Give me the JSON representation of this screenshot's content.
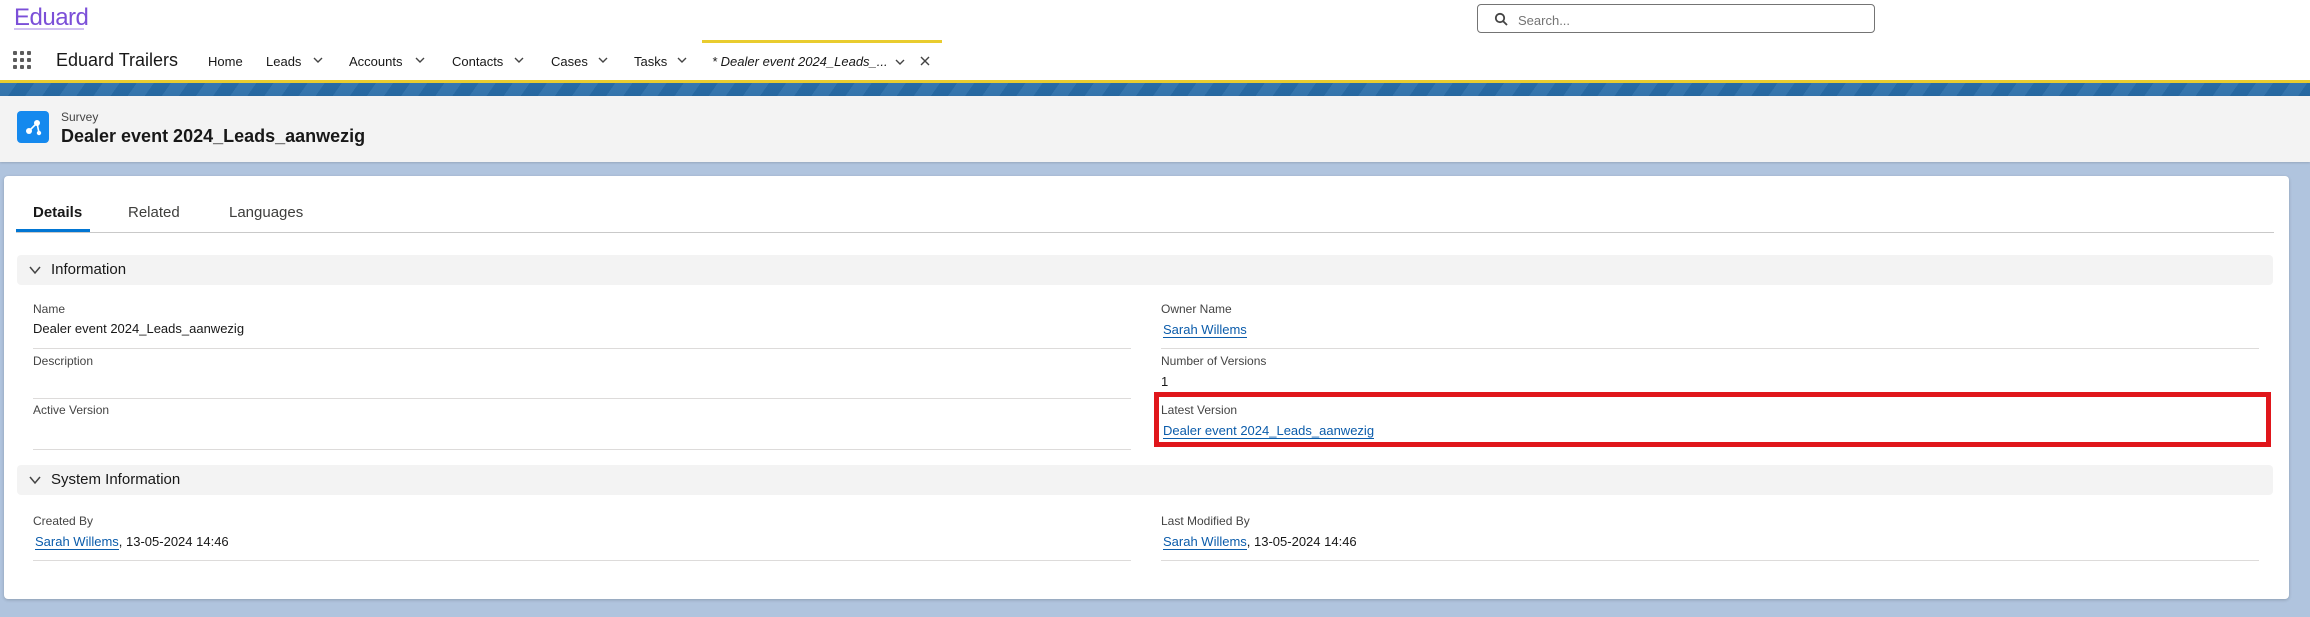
{
  "brand": {
    "logo_text": "Eduard",
    "accent": "#7b4fd8"
  },
  "search": {
    "placeholder": "Search...",
    "icon": "search-icon"
  },
  "nav": {
    "app_name": "Eduard Trailers",
    "items": [
      {
        "label": "Home",
        "has_menu": false
      },
      {
        "label": "Leads",
        "has_menu": true
      },
      {
        "label": "Accounts",
        "has_menu": true
      },
      {
        "label": "Contacts",
        "has_menu": true
      },
      {
        "label": "Cases",
        "has_menu": true
      },
      {
        "label": "Tasks",
        "has_menu": true
      }
    ],
    "active_tab": {
      "label": "* Dealer event 2024_Leads_...",
      "close_icon": "close-icon",
      "menu_icon": "chevron-down-icon"
    },
    "active_color": "#e9cc2f"
  },
  "record": {
    "object_label": "Survey",
    "title": "Dealer event 2024_Leads_aanwezig",
    "icon": "survey-icon",
    "icon_color": "#1589ee"
  },
  "tabs": [
    {
      "label": "Details",
      "active": true
    },
    {
      "label": "Related",
      "active": false
    },
    {
      "label": "Languages",
      "active": false
    }
  ],
  "sections": {
    "information": {
      "title": "Information",
      "fields": {
        "name": {
          "label": "Name",
          "value": "Dealer event 2024_Leads_aanwezig"
        },
        "owner_name": {
          "label": "Owner Name",
          "value": "Sarah Willems"
        },
        "description": {
          "label": "Description",
          "value": ""
        },
        "number_of_versions": {
          "label": "Number of Versions",
          "value": "1"
        },
        "active_version": {
          "label": "Active Version",
          "value": ""
        },
        "latest_version": {
          "label": "Latest Version",
          "value": "Dealer event 2024_Leads_aanwezig"
        }
      }
    },
    "system_information": {
      "title": "System Information",
      "fields": {
        "created_by": {
          "label": "Created By",
          "user": "Sarah Willems",
          "date": ", 13-05-2024 14:46"
        },
        "last_modified_by": {
          "label": "Last Modified By",
          "user": "Sarah Willems",
          "date": ", 13-05-2024 14:46"
        }
      }
    }
  },
  "colors": {
    "link": "#0b5cab",
    "highlight": "#e0161b",
    "tab_active": "#0176d3"
  }
}
